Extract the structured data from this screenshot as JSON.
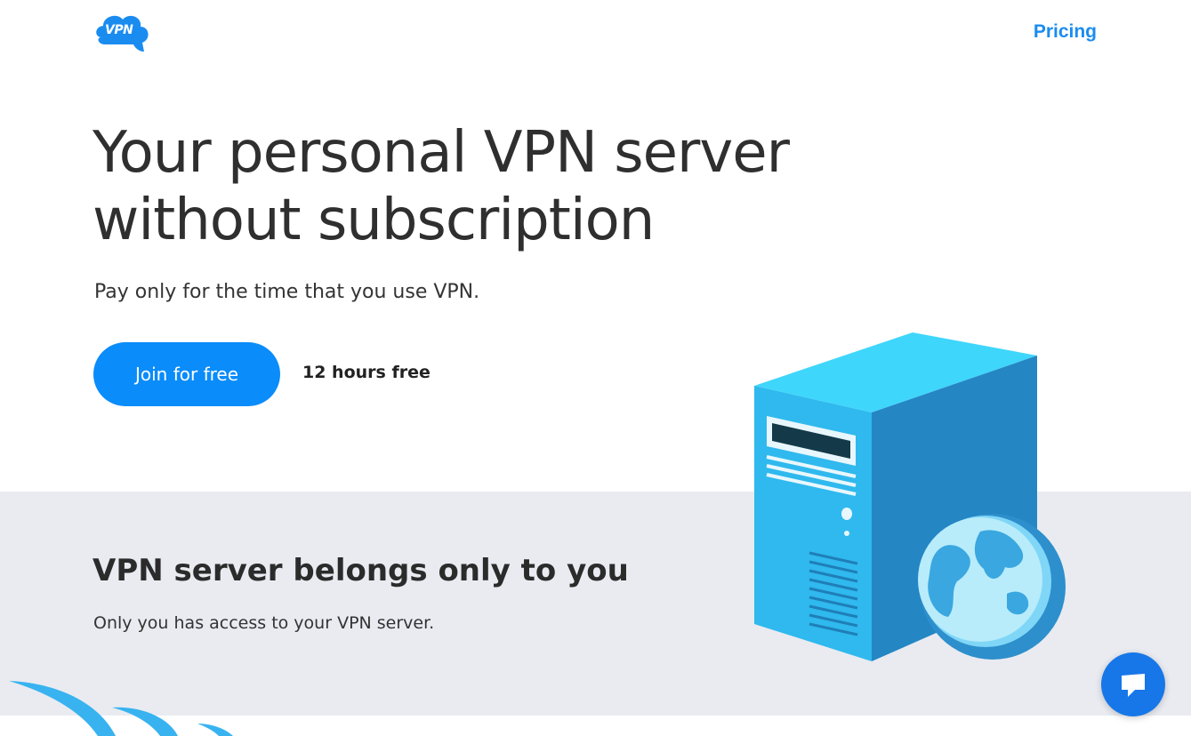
{
  "header": {
    "logo_text": "VPN",
    "nav_pricing": "Pricing"
  },
  "hero": {
    "title": "Your personal VPN server without subscription",
    "subtitle": "Pay only for the time that you use VPN.",
    "join_button": "Join for free",
    "free_note": "12 hours free"
  },
  "feature": {
    "title": "VPN server belongs only to you",
    "text": "Only you has access to your VPN server."
  },
  "icons": {
    "logo": "vpn-cloud-logo",
    "server": "server-globe-illustration",
    "chat": "chat-bubble-icon"
  },
  "colors": {
    "accent": "#0a8cfa",
    "link": "#1a8cf0",
    "band": "#e9ebf1",
    "chat": "#1777e8"
  }
}
